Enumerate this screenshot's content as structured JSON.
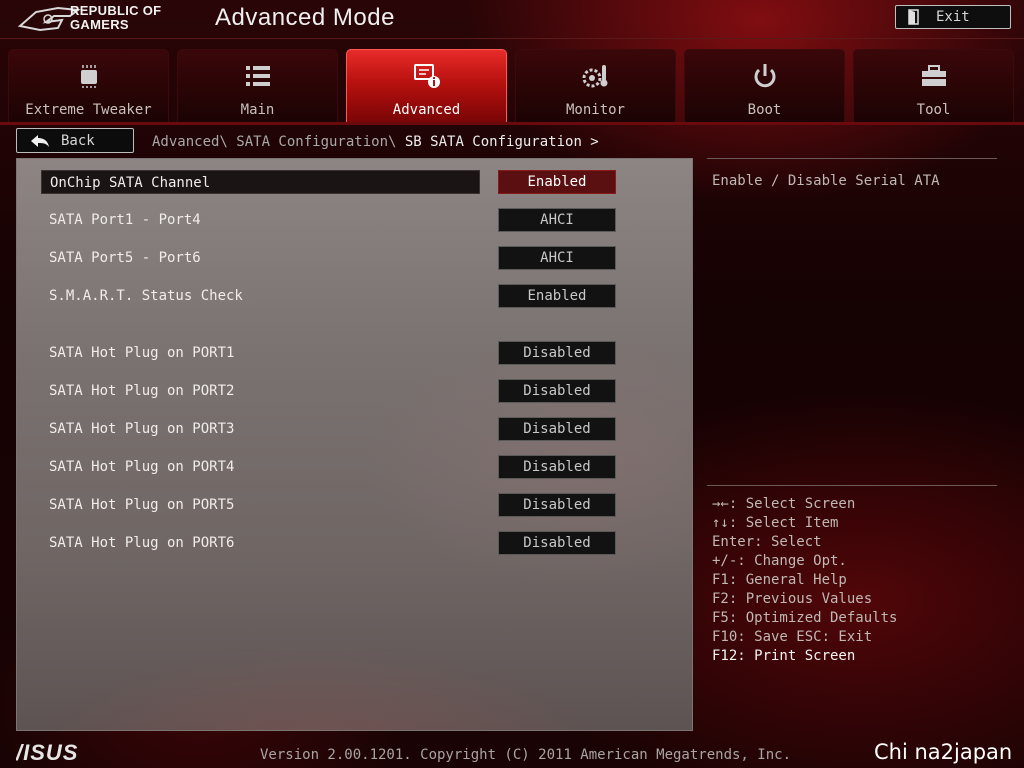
{
  "header": {
    "logo_line1": "REPUBLIC OF",
    "logo_line2": "GAMERS",
    "title": "Advanced Mode",
    "exit_label": "Exit"
  },
  "tabs": [
    {
      "label": "Extreme Tweaker",
      "icon": "cpu-chip-icon"
    },
    {
      "label": "Main",
      "icon": "list-icon"
    },
    {
      "label": "Advanced",
      "icon": "advanced-settings-icon",
      "active": true
    },
    {
      "label": "Monitor",
      "icon": "thermometer-gear-icon"
    },
    {
      "label": "Boot",
      "icon": "power-icon"
    },
    {
      "label": "Tool",
      "icon": "toolbox-icon"
    }
  ],
  "nav": {
    "back_label": "Back",
    "breadcrumb_path": "Advanced\\ SATA Configuration\\ ",
    "breadcrumb_current": "SB SATA Configuration >"
  },
  "settings": [
    {
      "name": "OnChip SATA Channel",
      "value": "Enabled",
      "selected": true
    },
    {
      "name": "SATA Port1 - Port4",
      "value": "AHCI"
    },
    {
      "name": "SATA Port5 - Port6",
      "value": "AHCI"
    },
    {
      "name": "S.M.A.R.T. Status Check",
      "value": "Enabled"
    },
    {
      "name": "SATA Hot Plug on PORT1",
      "value": "Disabled"
    },
    {
      "name": "SATA Hot Plug on PORT2",
      "value": "Disabled"
    },
    {
      "name": "SATA Hot Plug on PORT3",
      "value": "Disabled"
    },
    {
      "name": "SATA Hot Plug on PORT4",
      "value": "Disabled"
    },
    {
      "name": "SATA Hot Plug on PORT5",
      "value": "Disabled"
    },
    {
      "name": "SATA Hot Plug on PORT6",
      "value": "Disabled"
    }
  ],
  "help": {
    "description": "Enable / Disable Serial ATA",
    "keys": [
      "→←: Select Screen",
      "↑↓: Select Item",
      "Enter: Select",
      "+/-: Change Opt.",
      "F1: General Help",
      "F2: Previous Values",
      "F5: Optimized Defaults",
      "F10: Save  ESC: Exit",
      "F12: Print Screen"
    ]
  },
  "footer": {
    "brand": "ASUS",
    "version_text": "Version 2.00.1201. Copyright (C) 2011 American Megatrends, Inc.",
    "watermark": "Chi na2japan"
  },
  "colors": {
    "accent_red": "#c8161a",
    "selected_value_bg": "#5a1010",
    "panel_gray": "#7a7270"
  }
}
